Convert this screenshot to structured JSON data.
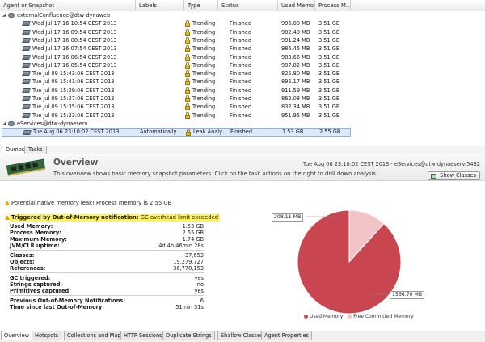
{
  "table": {
    "columns": [
      "Agent or Snapshot",
      "Labels",
      "Type",
      "Status",
      "Used Memo...",
      "Process M..."
    ],
    "agents": [
      {
        "name": "externalConfluence@dtw-dynaweb",
        "snapshots": [
          {
            "date": "Wed Jul 17 16:10:54 CEST 2013",
            "label": "",
            "type": "Trending",
            "status": "Finished",
            "used": "996.00 MB",
            "process": "3.51 GB"
          },
          {
            "date": "Wed Jul 17 16:09:54 CEST 2013",
            "label": "",
            "type": "Trending",
            "status": "Finished",
            "used": "982.49 MB",
            "process": "3.51 GB"
          },
          {
            "date": "Wed Jul 17 16:08:54 CEST 2013",
            "label": "",
            "type": "Trending",
            "status": "Finished",
            "used": "991.24 MB",
            "process": "3.51 GB"
          },
          {
            "date": "Wed Jul 17 16:07:54 CEST 2013",
            "label": "",
            "type": "Trending",
            "status": "Finished",
            "used": "986.45 MB",
            "process": "3.51 GB"
          },
          {
            "date": "Wed Jul 17 16:06:54 CEST 2013",
            "label": "",
            "type": "Trending",
            "status": "Finished",
            "used": "983.66 MB",
            "process": "3.51 GB"
          },
          {
            "date": "Wed Jul 17 16:05:54 CEST 2013",
            "label": "",
            "type": "Trending",
            "status": "Finished",
            "used": "997.82 MB",
            "process": "3.51 GB"
          },
          {
            "date": "Tue Jul 09 15:43:06 CEST 2013",
            "label": "",
            "type": "Trending",
            "status": "Finished",
            "used": "825.80 MB",
            "process": "3.51 GB"
          },
          {
            "date": "Tue Jul 09 15:41:06 CEST 2013",
            "label": "",
            "type": "Trending",
            "status": "Finished",
            "used": "895.17 MB",
            "process": "3.51 GB"
          },
          {
            "date": "Tue Jul 09 15:39:06 CEST 2013",
            "label": "",
            "type": "Trending",
            "status": "Finished",
            "used": "911.59 MB",
            "process": "3.51 GB"
          },
          {
            "date": "Tue Jul 09 15:37:06 CEST 2013",
            "label": "",
            "type": "Trending",
            "status": "Finished",
            "used": "862.08 MB",
            "process": "3.51 GB"
          },
          {
            "date": "Tue Jul 09 15:35:06 CEST 2013",
            "label": "",
            "type": "Trending",
            "status": "Finished",
            "used": "832.34 MB",
            "process": "3.51 GB"
          },
          {
            "date": "Tue Jul 09 15:33:06 CEST 2013",
            "label": "",
            "type": "Trending",
            "status": "Finished",
            "used": "951.95 MB",
            "process": "3.51 GB"
          }
        ]
      },
      {
        "name": "eServices@dtw-dynaeserv",
        "snapshots": [
          {
            "date": "Tue Aug 06 23:10:02 CEST 2013",
            "label": "Automatically ...",
            "type": "Leak Analy...",
            "status": "Finished",
            "used": "1.53 GB",
            "process": "2.55 GB"
          }
        ]
      }
    ]
  },
  "top_tabs": [
    "Dumps",
    "Tasks"
  ],
  "overview": {
    "title": "Overview",
    "description": "This overview shows basic memory snapshot parameters. Click on the task actions on the right to drill down analysis.",
    "date": "Tue Aug 06 23:10:02 CEST 2013 - eServices@dtw-dynaeserv:5432",
    "show_classes": "Show Classes",
    "native_warning": "Potential native memory leak! Process memory is 2.55 GB",
    "oom_prefix": "Triggered by Out-of-Memory notification:",
    "oom_reason": "GC overhead limit exceeded",
    "memory_stats": [
      {
        "k": "Used Memory:",
        "v": "1.53 GB"
      },
      {
        "k": "Process Memory:",
        "v": "2.55 GB"
      },
      {
        "k": "Maximum Memory:",
        "v": "1.74 GB"
      },
      {
        "k": "JVM/CLR uptime:",
        "v": "4d 4h 46min 28s"
      }
    ],
    "object_stats": [
      {
        "k": "Classes:",
        "v": "37,653"
      },
      {
        "k": "Objects:",
        "v": "19,279,727"
      },
      {
        "k": "References:",
        "v": "36,778,153"
      }
    ],
    "gc_stats": [
      {
        "k": "GC triggered:",
        "v": "yes"
      },
      {
        "k": "Strings captured:",
        "v": "no"
      },
      {
        "k": "Primitives captured:",
        "v": "yes"
      }
    ],
    "oom_stats": [
      {
        "k": "Previous Out-of-Memory Notifications:",
        "v": "6"
      },
      {
        "k": "Time since last Out-of-Memory:",
        "v": "51min 31s"
      }
    ]
  },
  "chart_data": {
    "type": "pie",
    "categories": [
      "Used Memory",
      "Free Committed Memory"
    ],
    "values": [
      1566.7,
      208.11
    ],
    "data_labels": [
      "1566.70 MB",
      "208.11 MB"
    ],
    "legend": "bottom",
    "colors": [
      "#c94650",
      "#f2c3c7"
    ]
  },
  "bottom_tabs": [
    "Overview",
    "Hotspots",
    "Collections and Maps",
    "HTTP Sessions",
    "Duplicate Strings",
    "Shallow Classes",
    "Agent Properties"
  ]
}
